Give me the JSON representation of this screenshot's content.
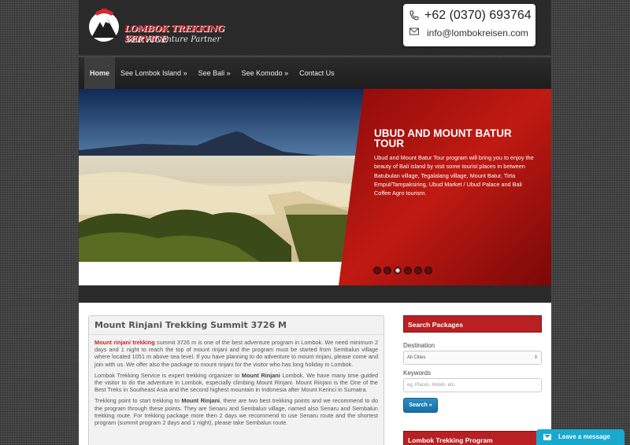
{
  "brand": {
    "title": "LOMBOK TREKKING SERVICE",
    "tagline": "Your Adventure Partner"
  },
  "contact": {
    "phone": "+62 (0370) 693764",
    "email": "info@lombokreisen.com",
    "phone_icon": "phone-icon",
    "email_icon": "envelope-icon"
  },
  "nav": {
    "items": [
      {
        "label": "Home",
        "active": true
      },
      {
        "label": "See Lombok Island »"
      },
      {
        "label": "See Bali »"
      },
      {
        "label": "See Komodo »"
      },
      {
        "label": "Contact Us"
      }
    ]
  },
  "slider": {
    "title": "UBUD AND MOUNT BATUR TOUR",
    "text": "Ubud and Mount Batur Tour program will bring you to enjoy the beauty of Bali island by visit some tourist places in between Batubulan village, Tegalalang village, Mount Batur, Tirta Empul/Tampaksiring, Ubud Market / Ubud Palace and Bali Coffee Agro tourism.",
    "dot_count": 6,
    "active_dot": 3
  },
  "article": {
    "title": "Mount Rinjani Trekking Summit 3726 M",
    "p1_highlight": "Mount rinjani trekking",
    "p1_rest": " summit 3726 m is one of the best adventure program in Lombok. We need minimum 2 days and 1 night to reach the top of mount rinjani and the program must be started from Sembalun village where located 1051 m above sea level.  If you have planning to do adventure to mount rinjani, please come and join with us. We offer also the package to mount rinjani for the visitor who has long holiday in Lombok.",
    "p2_a": "Lombok Trekking Service is expert trekking organizer to ",
    "p2_b": "Mount Rinjani",
    "p2_c": " Lombok. We have many time guided the visitor to do the adventure in Lombok, especially climbing Mount Rinjani. Mount Rinjani is the One of the Best Treks in Southeast Asia and the second highest mountain in Indonesia after Mount Kerinci in Sumatra.",
    "p3_a": "Trekking point to start trekking to ",
    "p3_b": "Mount Rinjani",
    "p3_c": ", there are two best trekking points and we recommend to do the program through these points. They are Senaru and Sembalun village, named also Senaru and Sembalun trekking route. For trekking package more then 2 days we recommend to use Senaru route and the shortest program (summit program 2 days and 1 night), please take Sembalun route."
  },
  "search": {
    "heading": "Search Packages",
    "destination_label": "Destination",
    "destination_value": "All Cities",
    "keywords_label": "Keywords",
    "keywords_placeholder": "eg. Places, Hotels, etc.",
    "button": "Search »"
  },
  "sidebar2": {
    "heading": "Lombok Trekking Program"
  },
  "chat": {
    "label": "Leave a message"
  },
  "colors": {
    "accent": "#b82023",
    "button": "#1a7bb2",
    "chat": "#19a9cf"
  }
}
